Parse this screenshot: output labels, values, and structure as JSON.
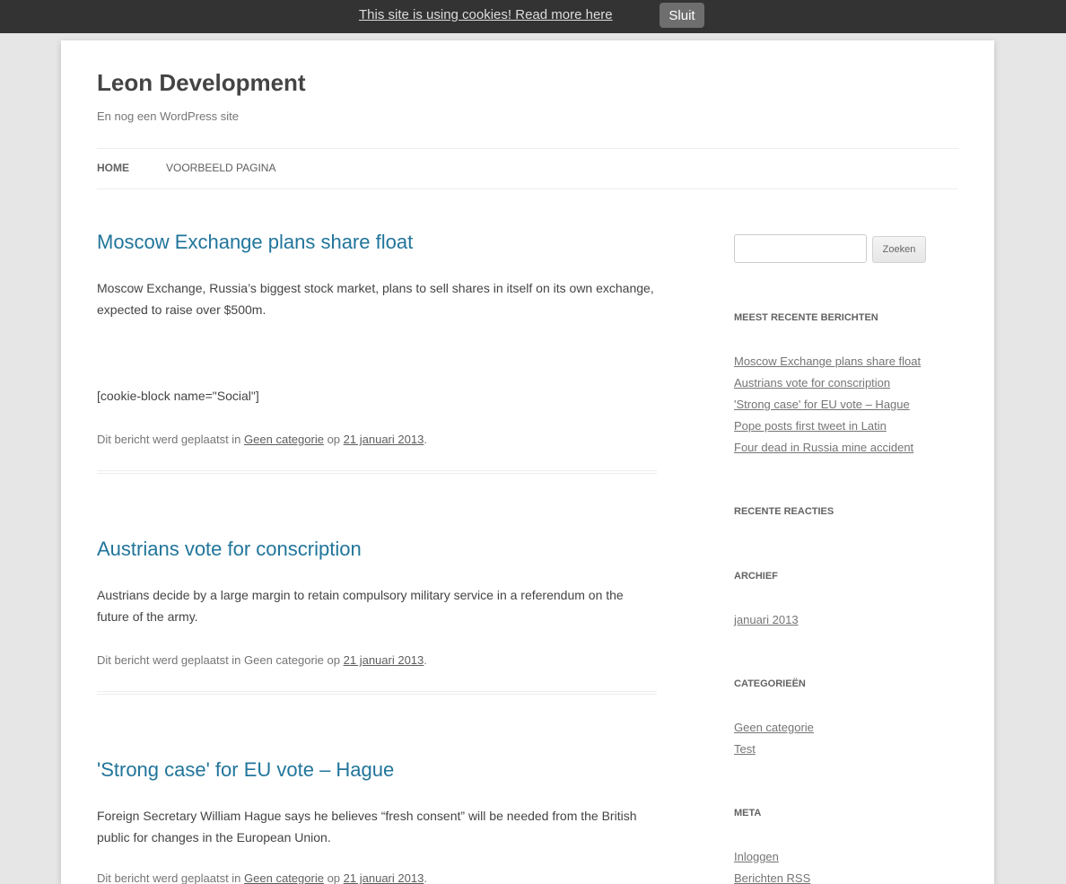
{
  "cookie_bar": {
    "message": "This site is using cookies! Read more here",
    "close_label": "Sluit"
  },
  "header": {
    "site_title": "Leon Development",
    "site_description": "En nog een WordPress site"
  },
  "nav": {
    "items": [
      {
        "label": "Home",
        "active": true
      },
      {
        "label": "Voorbeeld pagina",
        "active": false
      }
    ]
  },
  "posts": [
    {
      "title": "Moscow Exchange plans share float",
      "excerpt": "Moscow Exchange, Russia’s biggest stock market, plans to sell shares in itself on its own exchange, expected to raise over $500m.",
      "shortcode": "[cookie-block name=\"Social\"]",
      "meta_prefix": "Dit bericht werd geplaatst in",
      "category": "Geen categorie",
      "meta_mid": "op",
      "date": "21 januari 2013",
      "meta_suffix": "."
    },
    {
      "title": "Austrians vote for conscription",
      "excerpt": "Austrians decide by a large margin to retain compulsory military service in a referendum on the future of the army.",
      "meta_prefix": "Dit bericht werd geplaatst in Geen categorie op",
      "date": "21 januari 2013",
      "meta_suffix": "."
    },
    {
      "title": "'Strong case' for EU vote – Hague",
      "excerpt": "Foreign Secretary William Hague says he believes “fresh consent” will be needed from the British public for changes in the European Union.",
      "meta_prefix": "Dit bericht werd geplaatst in",
      "category": "Geen categorie",
      "meta_mid": "op",
      "date": "21 januari 2013",
      "meta_suffix": "."
    }
  ],
  "sidebar": {
    "search": {
      "placeholder": "",
      "button_label": "Zoeken"
    },
    "recent_posts": {
      "title": "Meest recente berichten",
      "items": [
        "Moscow Exchange plans share float",
        "Austrians vote for conscription",
        "'Strong case' for EU vote – Hague",
        "Pope posts first tweet in Latin",
        "Four dead in Russia mine accident"
      ]
    },
    "recent_comments": {
      "title": "Recente reacties"
    },
    "archive": {
      "title": "Archief",
      "items": [
        "januari 2013"
      ]
    },
    "categories": {
      "title": "Categorieën",
      "items": [
        "Geen categorie",
        "Test"
      ]
    },
    "meta": {
      "title": "Meta",
      "items": [
        "Inloggen",
        "Berichten RSS"
      ]
    }
  }
}
